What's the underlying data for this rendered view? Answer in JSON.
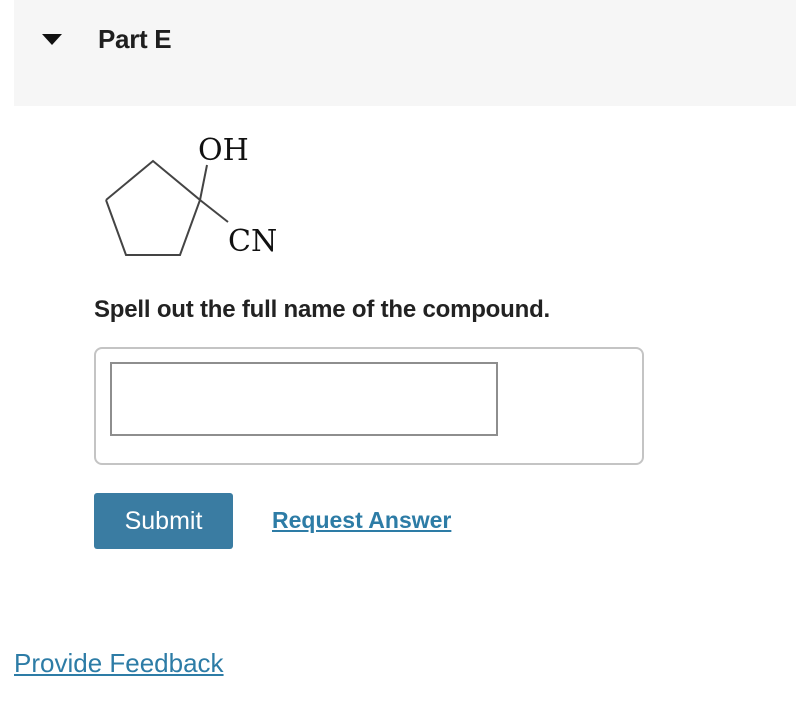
{
  "part": {
    "title": "Part E"
  },
  "structure": {
    "label_top": "OH",
    "label_bottom": "CN"
  },
  "question": {
    "prompt": "Spell out the full name of the compound."
  },
  "answer": {
    "value": "",
    "placeholder": ""
  },
  "actions": {
    "submit_label": "Submit",
    "request_answer_label": "Request Answer"
  },
  "footer": {
    "feedback_label": "Provide Feedback"
  },
  "colors": {
    "accent": "#3a7ca2",
    "link": "#2d7ca6",
    "header_bg": "#f6f6f6"
  }
}
